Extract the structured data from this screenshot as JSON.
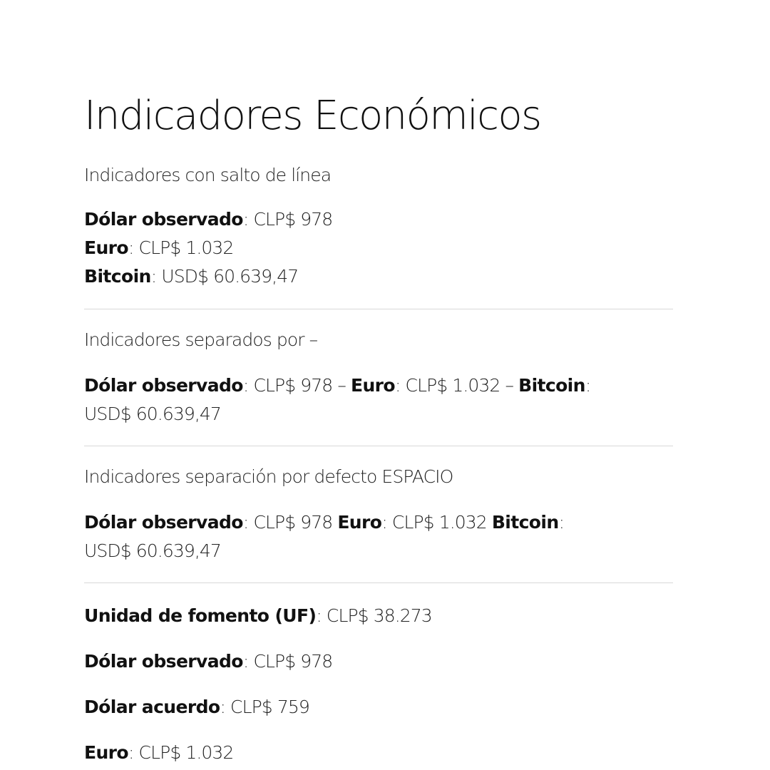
{
  "title": "Indicadores Económicos",
  "section1": {
    "heading": "Indicadores con salto de línea",
    "dolar_label": "Dólar observado",
    "dolar_value": ": CLP$ 978",
    "euro_label": "Euro",
    "euro_value": ": CLP$ 1.032",
    "bitcoin_label": "Bitcoin",
    "bitcoin_value": ": USD$ 60.639,47"
  },
  "section2": {
    "heading": "Indicadores separados por –",
    "dolar_label": "Dólar observado",
    "dolar_value": ": CLP$ 978 – ",
    "euro_label": "Euro",
    "euro_value": ": CLP$ 1.032 – ",
    "bitcoin_label": "Bitcoin",
    "bitcoin_value": ":",
    "bitcoin_value_2": "USD$ 60.639,47"
  },
  "section3": {
    "heading": "Indicadores separación por defecto ESPACIO",
    "dolar_label": "Dólar observado",
    "dolar_value": ": CLP$ 978 ",
    "euro_label": "Euro",
    "euro_value": ": CLP$ 1.032 ",
    "bitcoin_label": "Bitcoin",
    "bitcoin_value": ":",
    "bitcoin_value_2": "USD$ 60.639,47"
  },
  "section4": {
    "uf_label": "Unidad de fomento (UF)",
    "uf_value": ": CLP$ 38.273",
    "dolar_label": "Dólar observado",
    "dolar_value": ": CLP$ 978",
    "acuerdo_label": "Dólar acuerdo",
    "acuerdo_value": ": CLP$ 759",
    "euro_label": "Euro",
    "euro_value": ": CLP$ 1.032"
  }
}
